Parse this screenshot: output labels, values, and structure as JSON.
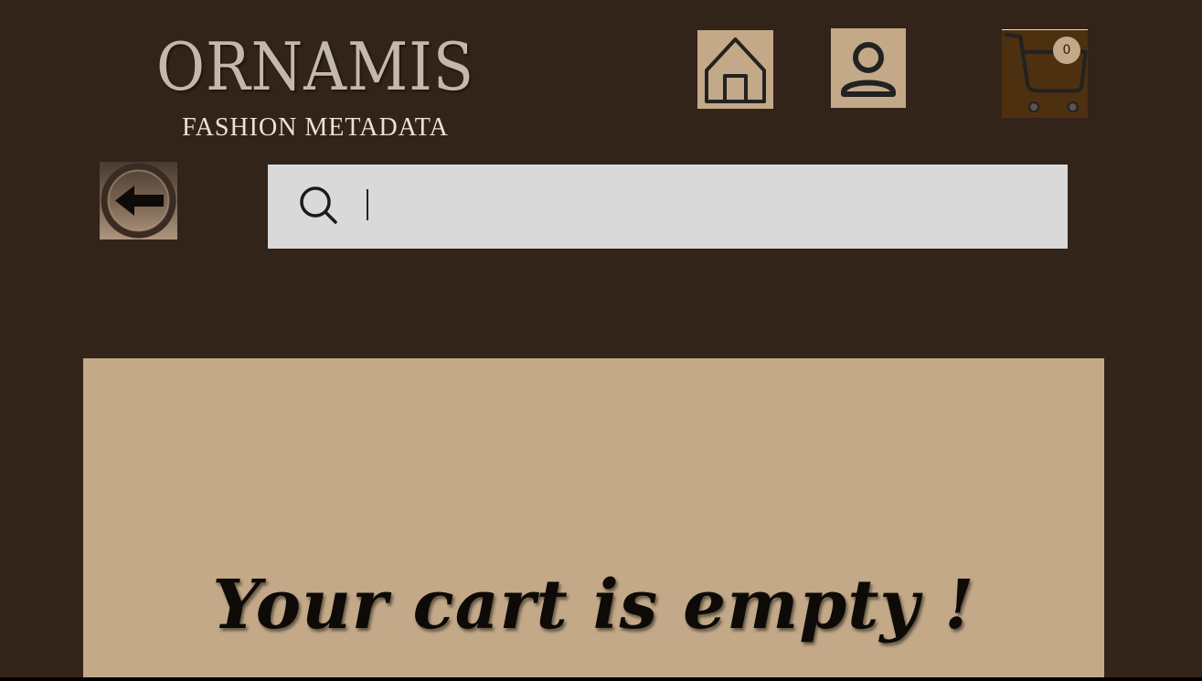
{
  "header": {
    "brand_name": "ORNAMIS",
    "brand_subtitle": "FASHION METADATA"
  },
  "nav": {
    "home_icon": "home-icon",
    "profile_icon": "user-icon",
    "cart_icon": "shopping-cart-icon",
    "cart_count": "0"
  },
  "back": {
    "icon": "arrow-left-circle-icon"
  },
  "search": {
    "icon": "search-icon",
    "value": "",
    "placeholder": ""
  },
  "cart": {
    "empty_message": "Your cart is empty !"
  },
  "colors": {
    "background": "#33241a",
    "panel": "#c3a988",
    "search_bar": "#d9d9d9",
    "cart_button": "#4c300f"
  }
}
